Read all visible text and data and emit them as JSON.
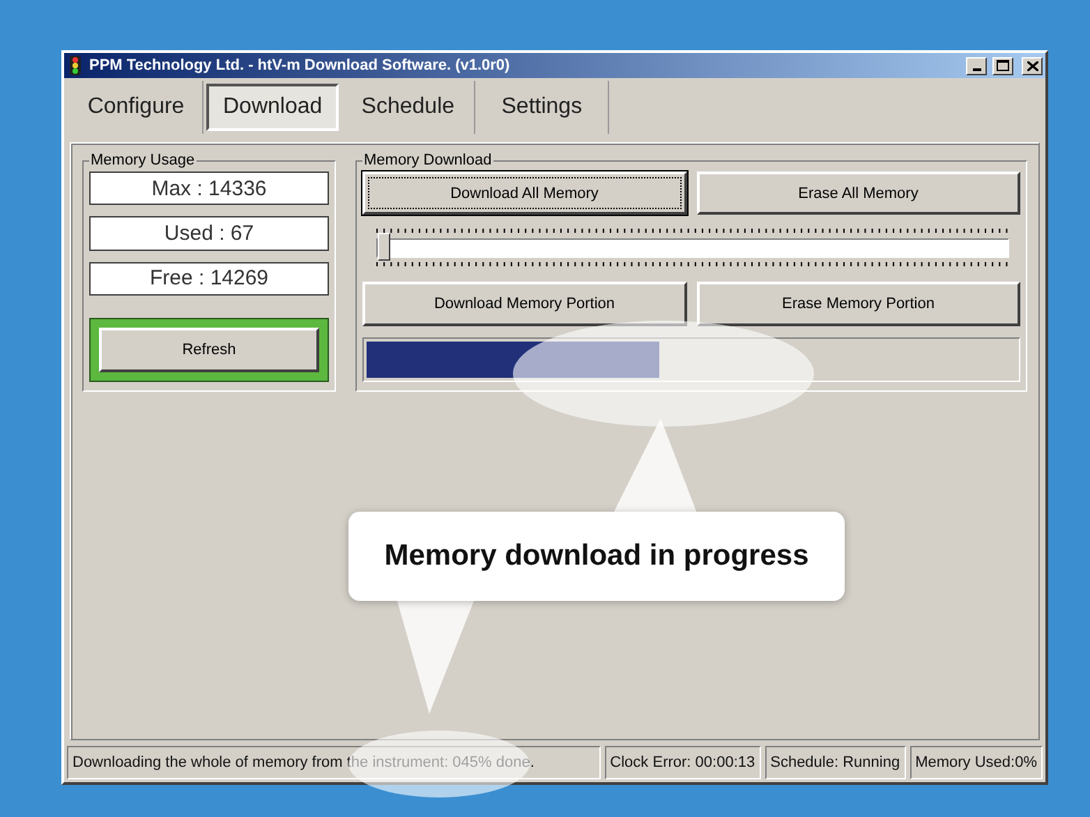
{
  "window": {
    "title": "PPM Technology Ltd. - htV-m Download Software. (v1.0r0)"
  },
  "tabs": [
    {
      "label": "Configure",
      "selected": false
    },
    {
      "label": "Download",
      "selected": true
    },
    {
      "label": "Schedule",
      "selected": false
    },
    {
      "label": "Settings",
      "selected": false
    }
  ],
  "memory_usage": {
    "title": "Memory Usage",
    "readouts": [
      "Max : 14336",
      "Used : 67",
      "Free : 14269"
    ],
    "refresh_button": {
      "label": "Refresh",
      "highlighted": true
    }
  },
  "memory_download": {
    "title": "Memory Download",
    "buttons": [
      {
        "label": "Download All Memory",
        "focused": true
      },
      {
        "label": "Erase All Memory",
        "focused": false
      },
      {
        "label": "Download Memory Portion",
        "focused": false
      },
      {
        "label": "Erase Memory Portion",
        "focused": false
      }
    ],
    "slider": {
      "level": 0
    },
    "progress": {
      "level": 0.45
    }
  },
  "status_bar": {
    "message": "Downloading the whole of memory from the instrument: 045% done.",
    "panels": [
      "Clock Error: 00:00:13",
      "Schedule: Running",
      "Memory Used:0%"
    ]
  },
  "callout": {
    "text": "Memory download in progress"
  }
}
